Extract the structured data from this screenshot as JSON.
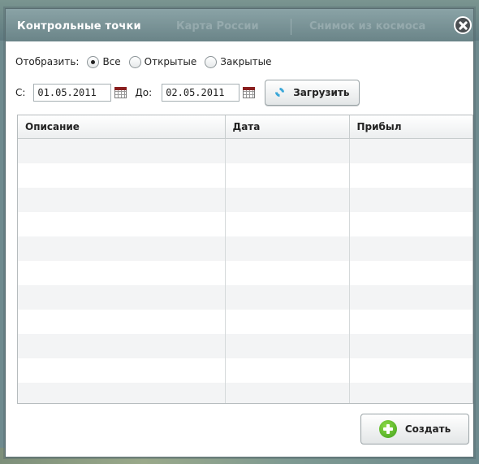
{
  "dialog": {
    "title": "Контрольные точки",
    "background_tabs": [
      "Карта России",
      "Снимок из космоса"
    ]
  },
  "filter": {
    "label": "Отобразить:",
    "options": [
      "Все",
      "Открытые",
      "Закрытые"
    ],
    "selected": "Все"
  },
  "dates": {
    "from_label": "С:",
    "from_value": "01.05.2011",
    "to_label": "До:",
    "to_value": "02.05.2011",
    "load_label": "Загрузить"
  },
  "table": {
    "columns": [
      "Описание",
      "Дата",
      "Прибыл"
    ],
    "rows": []
  },
  "actions": {
    "create_label": "Создать"
  },
  "colors": {
    "titlebar": "#7a9498",
    "accent_refresh": "#3aa7d8",
    "accent_create": "#4fb322"
  },
  "icons": [
    "close-icon",
    "calendar-icon",
    "refresh-icon",
    "plus-icon"
  ]
}
